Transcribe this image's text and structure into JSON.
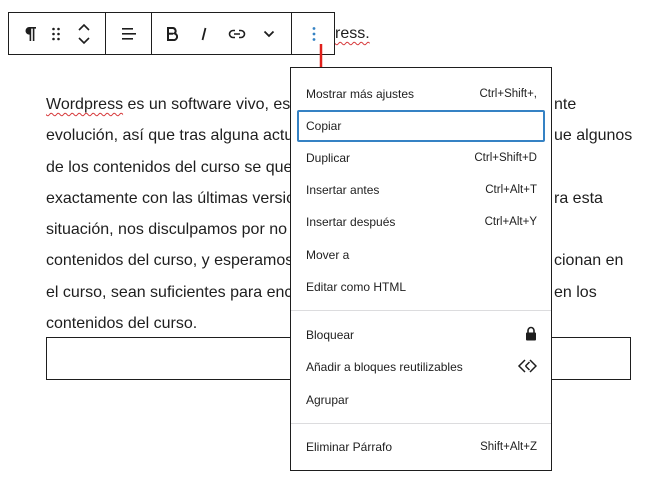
{
  "toolbar": {
    "buttons": [
      {
        "name": "paragraph",
        "icon": "pilcrow-icon"
      },
      {
        "name": "drag",
        "icon": "drag-handle-icon"
      },
      {
        "name": "move",
        "icon": "move-up-down-icon"
      },
      {
        "name": "align",
        "icon": "align-left-icon"
      },
      {
        "name": "bold",
        "icon": "bold-icon"
      },
      {
        "name": "italic",
        "icon": "italic-icon"
      },
      {
        "name": "link",
        "icon": "link-icon"
      },
      {
        "name": "more-rich-text",
        "icon": "chevron-down-icon"
      },
      {
        "name": "options",
        "icon": "more-vertical-icon"
      }
    ],
    "options_accent": "#3582c4"
  },
  "behind_toolbar_text": "ress.",
  "paragraph": {
    "lines": [
      {
        "spell": "Wordpress",
        "text": " es un software vivo, es",
        "tail": "nte"
      },
      {
        "text": "evolución, así que tras alguna actu",
        "tail": "ue algunos"
      },
      {
        "text": "de los contenidos del curso se que",
        "tail": ""
      },
      {
        "text": "exactamente con las últimas versic",
        "tail": "ra esta"
      },
      {
        "text": "situación, nos disculpamos por no",
        "tail": ""
      },
      {
        "text": "contenidos del curso, y esperamos",
        "tail": "cionan en"
      },
      {
        "text": "el curso, sean suficientes para enco",
        "tail": "en los"
      },
      {
        "text": "contenidos del curso.",
        "tail": ""
      }
    ]
  },
  "annotation_arrow_color": "#e0201b",
  "menu": {
    "groups": [
      [
        {
          "label": "Mostrar más ajustes",
          "shortcut": "Ctrl+Shift+,"
        },
        {
          "label": "Copiar",
          "shortcut": "",
          "focused": true
        },
        {
          "label": "Duplicar",
          "shortcut": "Ctrl+Shift+D"
        },
        {
          "label": "Insertar antes",
          "shortcut": "Ctrl+Alt+T"
        },
        {
          "label": "Insertar después",
          "shortcut": "Ctrl+Alt+Y"
        },
        {
          "label": "Mover a",
          "shortcut": ""
        },
        {
          "label": "Editar como HTML",
          "shortcut": ""
        }
      ],
      [
        {
          "label": "Bloquear",
          "icon": "lock-icon"
        },
        {
          "label": "Añadir a bloques reutilizables",
          "icon": "reusable-block-icon"
        },
        {
          "label": "Agrupar"
        }
      ],
      [
        {
          "label": "Eliminar Párrafo",
          "shortcut": "Shift+Alt+Z"
        }
      ]
    ]
  }
}
